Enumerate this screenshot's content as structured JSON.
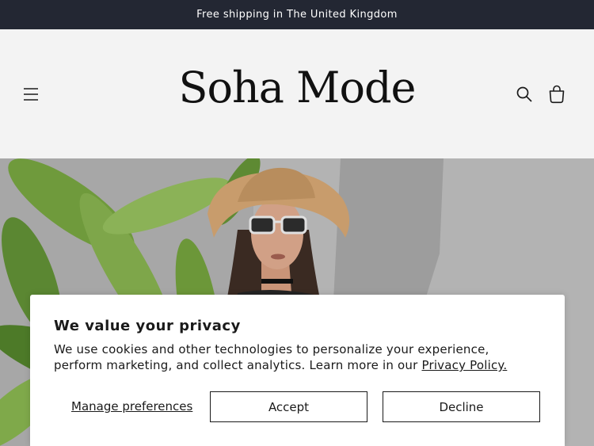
{
  "announcement": {
    "text": "Free shipping in The United Kingdom"
  },
  "header": {
    "logo": "Soha Mode",
    "icons": {
      "menu": "menu-icon",
      "search": "search-icon",
      "cart": "cart-icon"
    }
  },
  "hero": {
    "image": "woman in straw hat and sunglasses beside tropical leaves"
  },
  "cookie_banner": {
    "title": "We value your privacy",
    "body": "We use cookies and other technologies to personalize your experience, perform marketing, and collect analytics. Learn more in our ",
    "policy_link": "Privacy Policy.",
    "manage_label": "Manage preferences",
    "accept_label": "Accept",
    "decline_label": "Decline"
  },
  "colors": {
    "announcement_bg": "#232733",
    "header_bg": "#f3f3f3",
    "text": "#1a1a1a",
    "button_border": "#1a1a1a"
  }
}
